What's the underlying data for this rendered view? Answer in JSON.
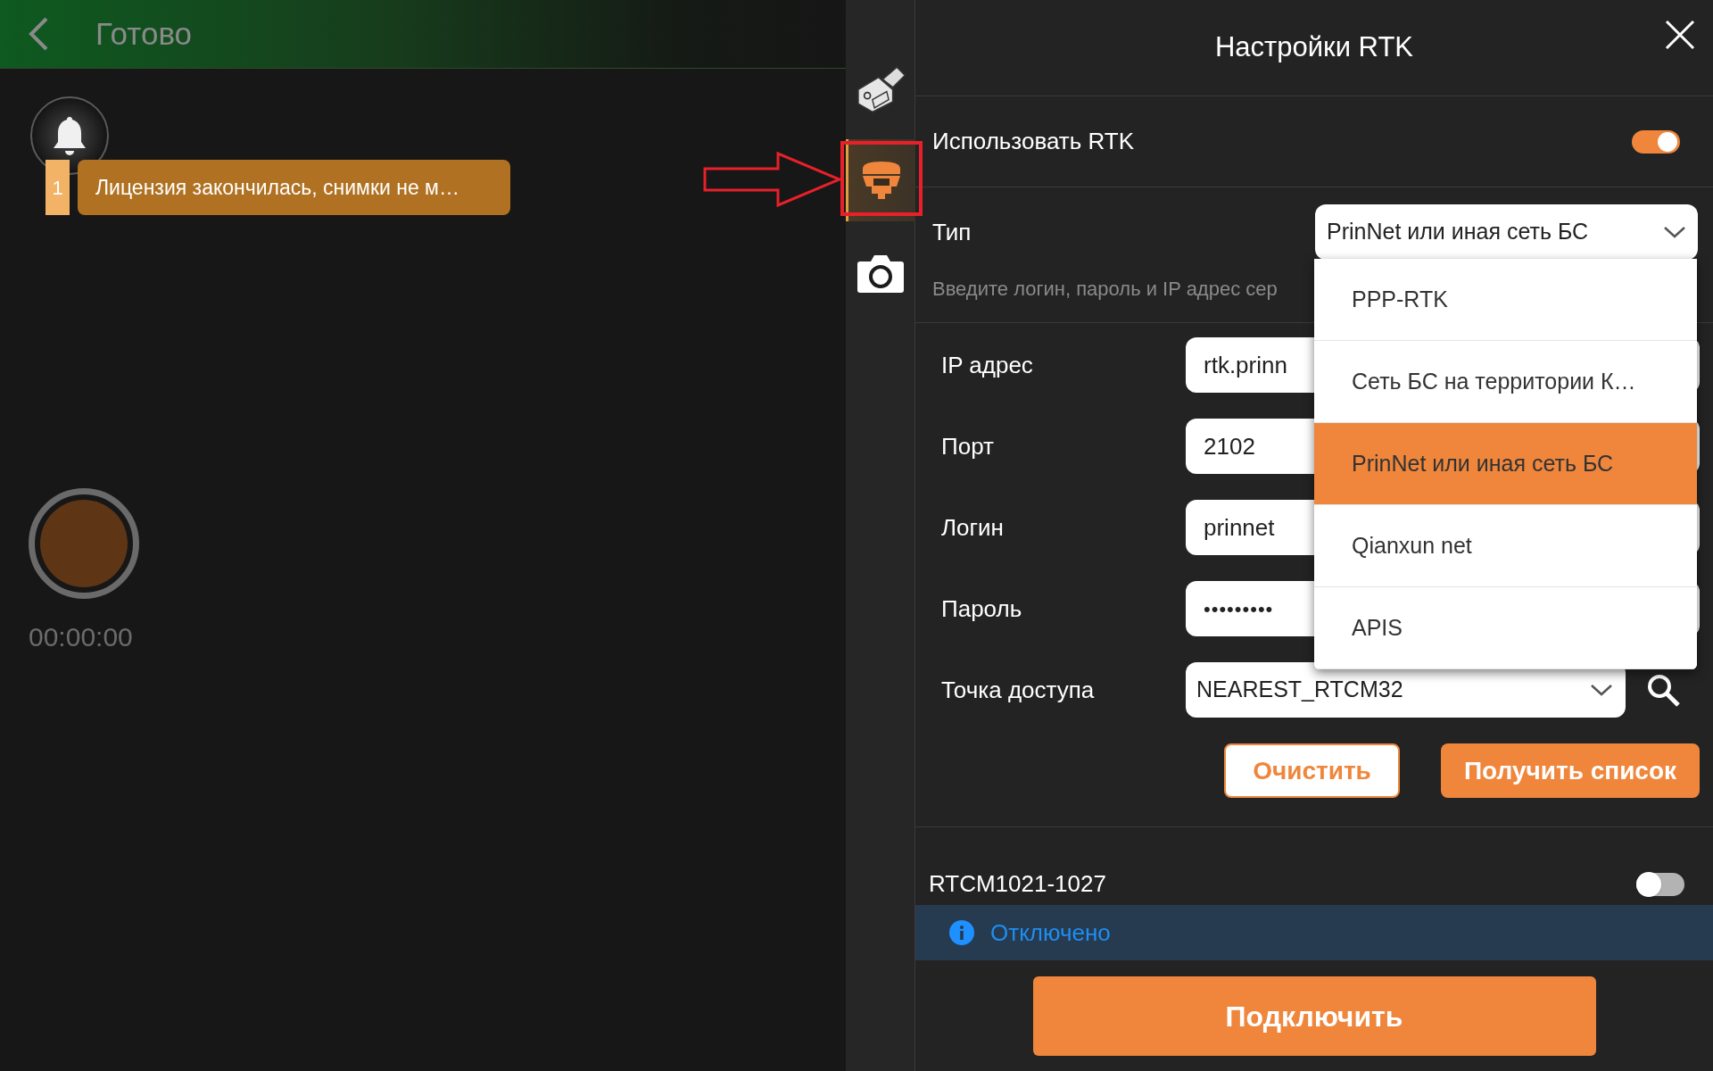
{
  "top_bar": {
    "title": "Готово"
  },
  "notification": {
    "count": "1",
    "message": "Лицензия закончилась, снимки не м…"
  },
  "recorder": {
    "time": "00:00:00"
  },
  "sidebar": {
    "items": [
      {
        "kind": "sensor",
        "selected": false
      },
      {
        "kind": "receiver",
        "selected": true
      },
      {
        "kind": "camera",
        "selected": false
      }
    ]
  },
  "panel": {
    "title": "Настройки RTK",
    "use_rtk": {
      "label": "Использовать RTK",
      "on": true
    },
    "type": {
      "label": "Тип",
      "value": "PrinNet или иная сеть БС",
      "open": true
    },
    "hint": "Введите логин, пароль и IP адрес сер",
    "fields": [
      {
        "label": "IP адрес",
        "value": "rtk.prinn",
        "kind": "text"
      },
      {
        "label": "Порт",
        "value": "2102",
        "kind": "text"
      },
      {
        "label": "Логин",
        "value": "prinnet",
        "kind": "text"
      },
      {
        "label": "Пароль",
        "value": "•••••••••",
        "kind": "password"
      },
      {
        "label": "Точка доступа",
        "value": "NEAREST_RTCM32",
        "kind": "select"
      }
    ],
    "buttons": [
      {
        "label": "Очистить",
        "kind": "outline"
      },
      {
        "label": "Получить список",
        "kind": "filled"
      }
    ],
    "rtcm": {
      "label": "RTCM1021-1027",
      "on": false
    },
    "status": {
      "text": "Отключено"
    },
    "connect_button": "Подключить"
  },
  "dropdown": {
    "options": [
      {
        "label": "PPP-RTK",
        "selected": false
      },
      {
        "label": "Сеть БС на территории К…",
        "selected": false
      },
      {
        "label": "PrinNet или иная сеть БС",
        "selected": true
      },
      {
        "label": "Qianxun net",
        "selected": false
      },
      {
        "label": "APIS",
        "selected": false
      }
    ]
  }
}
